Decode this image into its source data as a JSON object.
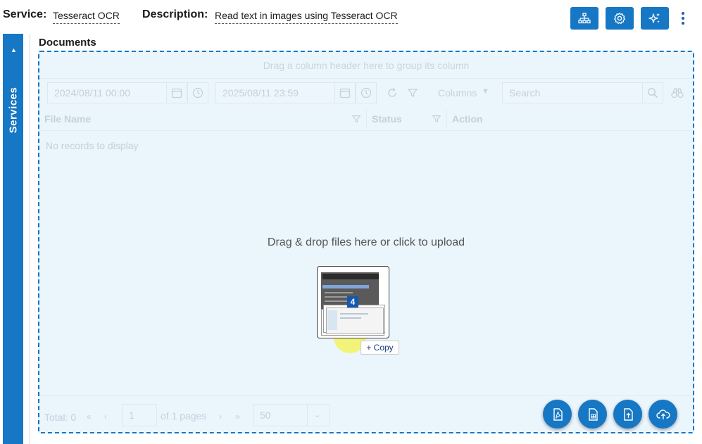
{
  "header": {
    "service_label": "Service:",
    "service_value": "Tesseract OCR",
    "description_label": "Description:",
    "description_value": "Read text in images using Tesseract OCR",
    "buttons": [
      "sitemap-icon",
      "gear-icon",
      "sparkle-icon"
    ],
    "more_icon": "kebab-menu-icon"
  },
  "sidebar": {
    "title": "Services",
    "collapse_icon": "collapse-arrow-icon"
  },
  "documents": {
    "title": "Documents",
    "group_hint": "Drag a column header here to group its column",
    "toolbar": {
      "start_date": "2024/08/11 00:00",
      "end_date": "2025/08/11 23:59",
      "columns_label": "Columns",
      "search_placeholder": "Search"
    },
    "columns": [
      "File Name",
      "Status",
      "Action"
    ],
    "empty_text": "No records to display",
    "pager": {
      "total": "Total: 0",
      "page": "1",
      "of_pages": "of 1 pages",
      "page_size": "50"
    },
    "dropzone_text": "Drag & drop files here or click to upload",
    "drag_count": "4",
    "copy_label": "+ Copy"
  },
  "fab_buttons": [
    "pdf-file-icon",
    "spreadsheet-file-icon",
    "upload-file-icon",
    "cloud-upload-icon"
  ],
  "colors": {
    "accent": "#1677c5",
    "dropzone_bg": "#eaf5fc",
    "highlight": "#f2f47a"
  }
}
